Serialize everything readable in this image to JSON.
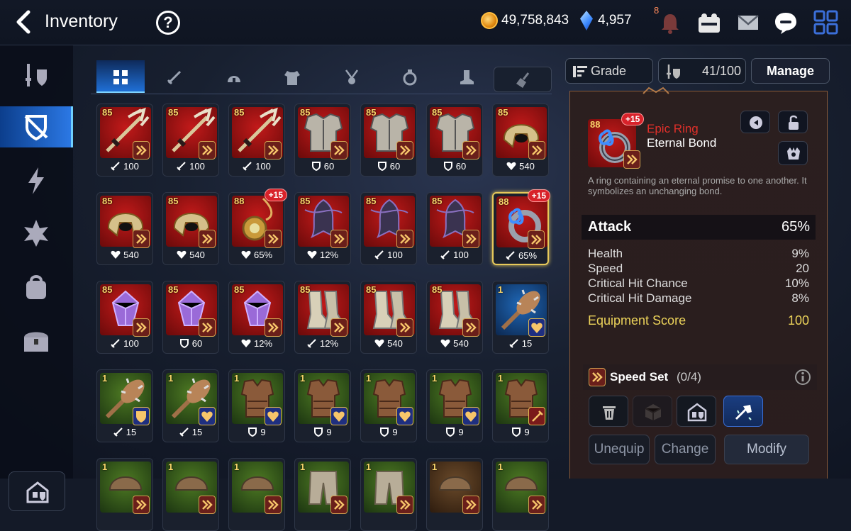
{
  "header": {
    "title": "Inventory",
    "help_symbol": "?",
    "gold": "49,758,843",
    "crystals": "4,957",
    "notification_count": "8"
  },
  "tabs": [
    "all-icon",
    "weapon-icon",
    "helmet-icon",
    "armor-icon",
    "necklace-icon",
    "ring-icon",
    "boots-icon"
  ],
  "controls": {
    "sort_label": "Grade",
    "capacity": "41/100",
    "manage_label": "Manage"
  },
  "grid": [
    {
      "lvl": "85",
      "stat": "100",
      "stype": "attack",
      "art": "trident",
      "bg": "red"
    },
    {
      "lvl": "85",
      "stat": "100",
      "stype": "attack",
      "art": "trident",
      "bg": "red"
    },
    {
      "lvl": "85",
      "stat": "100",
      "stype": "attack",
      "art": "trident",
      "bg": "red"
    },
    {
      "lvl": "85",
      "stat": "60",
      "stype": "defense",
      "art": "armor",
      "bg": "red"
    },
    {
      "lvl": "85",
      "stat": "60",
      "stype": "defense",
      "art": "armor",
      "bg": "red"
    },
    {
      "lvl": "85",
      "stat": "60",
      "stype": "defense",
      "art": "armor",
      "bg": "red"
    },
    {
      "lvl": "85",
      "stat": "540",
      "stype": "health",
      "art": "helmet",
      "bg": "red"
    },
    {
      "lvl": "85",
      "stat": "540",
      "stype": "health",
      "art": "helmet",
      "bg": "red"
    },
    {
      "lvl": "85",
      "stat": "540",
      "stype": "health",
      "art": "helmet",
      "bg": "red"
    },
    {
      "lvl": "88",
      "stat": "65%",
      "stype": "health",
      "art": "necklace",
      "bg": "red",
      "plus": "+15"
    },
    {
      "lvl": "85",
      "stat": "12%",
      "stype": "health",
      "art": "amulet",
      "bg": "red"
    },
    {
      "lvl": "85",
      "stat": "100",
      "stype": "attack",
      "art": "amulet",
      "bg": "red"
    },
    {
      "lvl": "85",
      "stat": "100",
      "stype": "attack",
      "art": "amulet",
      "bg": "red"
    },
    {
      "lvl": "88",
      "stat": "65%",
      "stype": "attack",
      "art": "ring",
      "bg": "red",
      "plus": "+15",
      "selected": true
    },
    {
      "lvl": "85",
      "stat": "100",
      "stype": "attack",
      "art": "crystal",
      "bg": "red"
    },
    {
      "lvl": "85",
      "stat": "60",
      "stype": "defense",
      "art": "crystal",
      "bg": "red"
    },
    {
      "lvl": "85",
      "stat": "12%",
      "stype": "health",
      "art": "crystal",
      "bg": "red"
    },
    {
      "lvl": "85",
      "stat": "12%",
      "stype": "attack",
      "art": "boots",
      "bg": "red"
    },
    {
      "lvl": "85",
      "stat": "540",
      "stype": "health",
      "art": "boots",
      "bg": "red"
    },
    {
      "lvl": "85",
      "stat": "540",
      "stype": "health",
      "art": "boots",
      "bg": "red"
    },
    {
      "lvl": "1",
      "stat": "15",
      "stype": "attack",
      "art": "club",
      "bg": "blue",
      "set": "heart"
    },
    {
      "lvl": "1",
      "stat": "15",
      "stype": "attack",
      "art": "club",
      "bg": "green",
      "set": "shield"
    },
    {
      "lvl": "1",
      "stat": "15",
      "stype": "attack",
      "art": "club",
      "bg": "green",
      "set": "heart"
    },
    {
      "lvl": "1",
      "stat": "9",
      "stype": "defense",
      "art": "vest",
      "bg": "green",
      "set": "heart"
    },
    {
      "lvl": "1",
      "stat": "9",
      "stype": "defense",
      "art": "vest",
      "bg": "green",
      "set": "heart"
    },
    {
      "lvl": "1",
      "stat": "9",
      "stype": "defense",
      "art": "vest",
      "bg": "green",
      "set": "heart"
    },
    {
      "lvl": "1",
      "stat": "9",
      "stype": "defense",
      "art": "vest",
      "bg": "green",
      "set": "heart"
    },
    {
      "lvl": "1",
      "stat": "9",
      "stype": "defense",
      "art": "vest",
      "bg": "green",
      "set": "sword"
    },
    {
      "lvl": "1",
      "stat": "",
      "stype": "",
      "art": "cap",
      "bg": "green"
    },
    {
      "lvl": "1",
      "stat": "",
      "stype": "",
      "art": "cap",
      "bg": "green"
    },
    {
      "lvl": "1",
      "stat": "",
      "stype": "",
      "art": "cap",
      "bg": "green"
    },
    {
      "lvl": "1",
      "stat": "",
      "stype": "",
      "art": "pants",
      "bg": "green"
    },
    {
      "lvl": "1",
      "stat": "",
      "stype": "",
      "art": "pants",
      "bg": "green"
    },
    {
      "lvl": "1",
      "stat": "",
      "stype": "",
      "art": "cap",
      "bg": "brown"
    },
    {
      "lvl": "1",
      "stat": "",
      "stype": "",
      "art": "cap",
      "bg": "green"
    }
  ],
  "detail": {
    "level": "88",
    "plus": "+15",
    "grade": "Epic Ring",
    "name": "Eternal Bond",
    "description": "A ring containing an eternal promise to one another. It symbolizes an unchanging bond.",
    "main_stat": {
      "label": "Attack",
      "value": "65%"
    },
    "substats": [
      {
        "label": "Health",
        "value": "9%"
      },
      {
        "label": "Speed",
        "value": "20"
      },
      {
        "label": "Critical Hit Chance",
        "value": "10%"
      },
      {
        "label": "Critical Hit Damage",
        "value": "8%"
      }
    ],
    "score": {
      "label": "Equipment Score",
      "value": "100"
    },
    "set": {
      "name": "Speed Set",
      "count": "(0/4)"
    },
    "buttons": {
      "unequip": "Unequip",
      "change": "Change",
      "modify": "Modify"
    }
  }
}
